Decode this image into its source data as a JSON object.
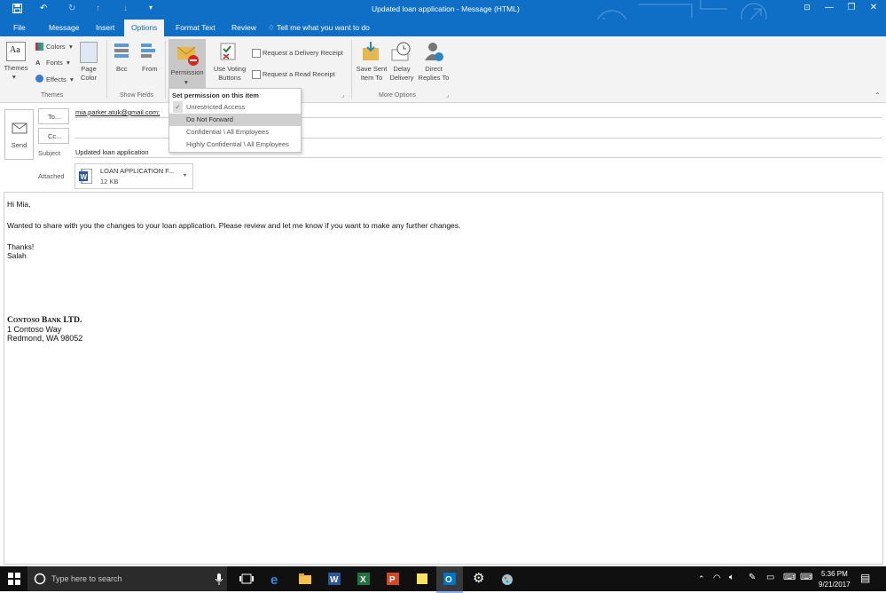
{
  "title_bar": {
    "title": "Updated loan application  -  Message (HTML)",
    "save_icon": "save-icon",
    "undo_icon": "undo-icon",
    "redo_icon": "redo-icon",
    "up_icon": "up-arrow-icon",
    "down_icon": "down-arrow-icon",
    "customize_icon": "chevron-down-icon"
  },
  "tabs": [
    "File",
    "Message",
    "Insert",
    "Options",
    "Format Text",
    "Review"
  ],
  "active_tab": "Options",
  "tell_me": "Tell me what you want to do",
  "ribbon": {
    "themes_label": "Themes",
    "colors_label": "Colors",
    "fonts_label": "Fonts",
    "effects_label": "Effects",
    "page_color_label": "Page Color",
    "bcc_label": "Bcc",
    "from_label": "From",
    "permission_label": "Permission",
    "voting_label": "Use Voting Buttons",
    "delivery_receipt_label": "Request a Delivery Receipt",
    "read_receipt_label": "Request a Read Receipt",
    "save_sent_label": "Save Sent Item To",
    "delay_label": "Delay Delivery",
    "direct_label": "Direct Replies To",
    "group_themes": "Themes",
    "group_show_fields": "Show Fields",
    "group_more_options": "More Options"
  },
  "permission_dropdown": {
    "header": "Set permission on this item",
    "items": [
      "Unrestricted Access",
      "Do Not Forward",
      "Confidential \\ All Employees",
      "Highly Confidential \\ All Employees"
    ],
    "checked": "Unrestricted Access",
    "highlighted": "Do Not Forward"
  },
  "compose": {
    "send_label": "Send",
    "to_label": "To...",
    "cc_label": "Cc...",
    "subject_label": "Subject",
    "attached_label": "Attached",
    "to_value": "mia.parker.atuk@gmail.com;",
    "cc_value": "",
    "subject_value": "Updated loan application",
    "attachment_name": "LOAN APPLICATION F...",
    "attachment_size": "12 KB"
  },
  "body": {
    "greeting": "Hi Mia,",
    "line1": "Wanted to share with you the changes to your loan application. Please review and let me know if you want to make any further changes.",
    "thanks": "Thanks!",
    "sign": "Salah",
    "company": "Contoso Bank LTD.",
    "address1": "1 Contoso Way",
    "address2": "Redmond, WA 98052"
  },
  "taskbar": {
    "search_placeholder": "Type here to search",
    "time": "5:36 PM",
    "date": "9/21/2017"
  },
  "colors": {
    "accent": "#0f6fc6",
    "ribbon_bg": "#f3f3f3",
    "taskbar": "#101010"
  }
}
